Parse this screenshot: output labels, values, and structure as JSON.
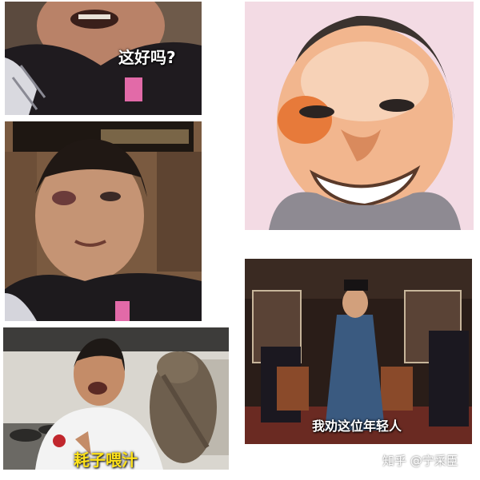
{
  "panels": [
    {
      "id": "p1",
      "caption": "这好吗?"
    },
    {
      "id": "p2"
    },
    {
      "id": "p3",
      "caption": "耗子喂汁"
    },
    {
      "id": "p4"
    },
    {
      "id": "p5",
      "caption": "我劝这位年轻人"
    }
  ],
  "watermark": "知乎 @宁采臣"
}
